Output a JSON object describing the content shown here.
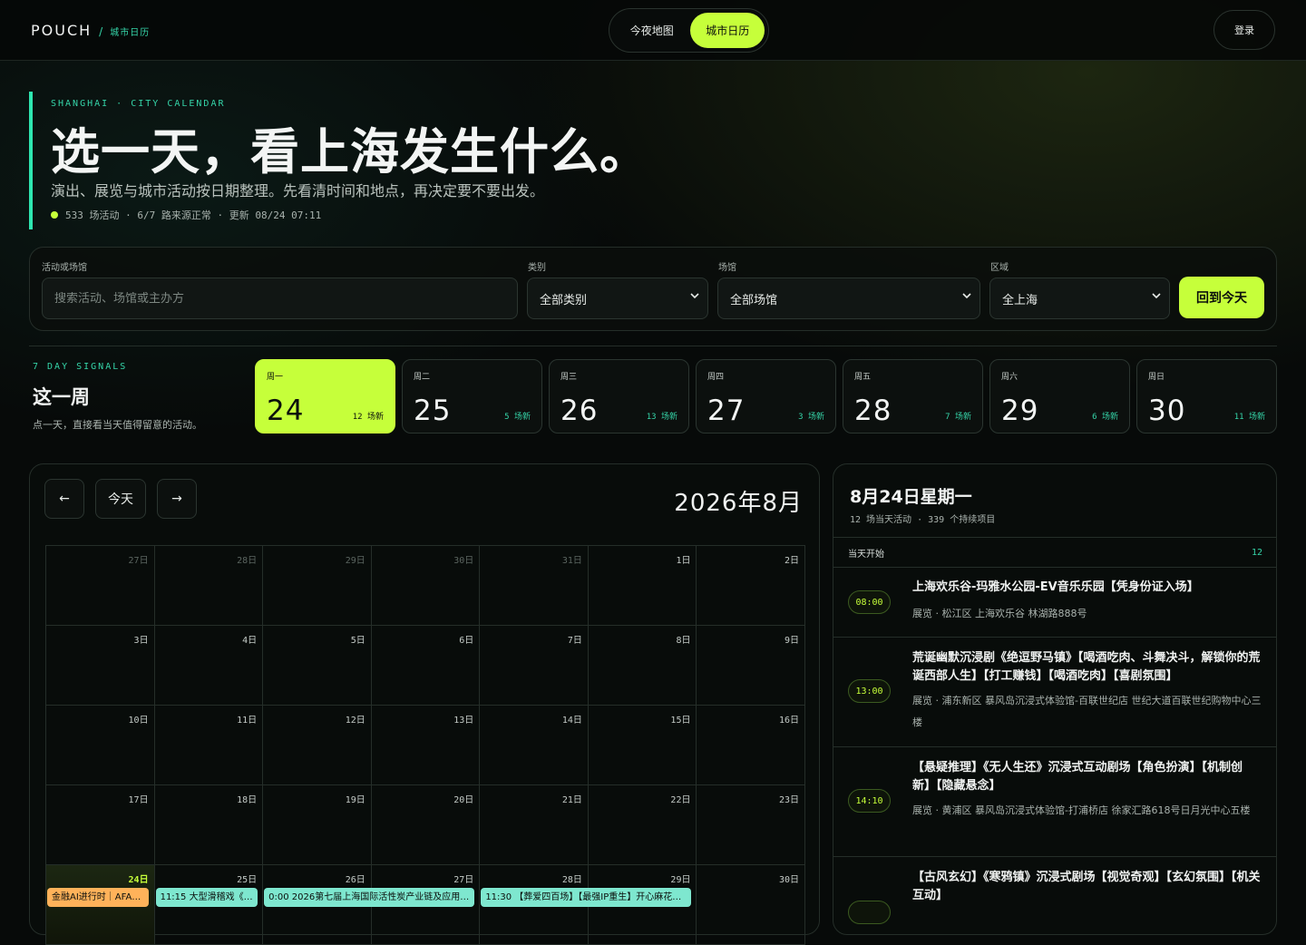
{
  "app": {
    "brand": "POUCH",
    "slash": "/",
    "section": "城市日历"
  },
  "nav": {
    "tab1": "今夜地图",
    "tab2": "城市日历",
    "login": "登录"
  },
  "hero": {
    "eyebrow": "SHANGHAI · CITY CALENDAR",
    "title": "选一天，看上海发生什么。",
    "desc": "演出、展览与城市活动按日期整理。先看清时间和地点，再决定要不要出发。",
    "status": "533 场活动 · 6/7 路来源正常 · 更新 08/24 07:11"
  },
  "filters": {
    "search_label": "活动或场馆",
    "search_placeholder": "搜索活动、场馆或主办方",
    "category_label": "类别",
    "category_value": "全部类别",
    "venue_label": "场馆",
    "venue_value": "全部场馆",
    "area_label": "区域",
    "area_value": "全上海",
    "today_button": "回到今天"
  },
  "week": {
    "eyebrow": "7 DAY SIGNALS",
    "title": "这一周",
    "desc": "点一天，直接看当天值得留意的活动。",
    "days": [
      {
        "weekday": "周一",
        "day": "24",
        "count": "12 场新"
      },
      {
        "weekday": "周二",
        "day": "25",
        "count": "5 场新"
      },
      {
        "weekday": "周三",
        "day": "26",
        "count": "13 场新"
      },
      {
        "weekday": "周四",
        "day": "27",
        "count": "3 场新"
      },
      {
        "weekday": "周五",
        "day": "28",
        "count": "7 场新"
      },
      {
        "weekday": "周六",
        "day": "29",
        "count": "6 场新"
      },
      {
        "weekday": "周日",
        "day": "30",
        "count": "11 场新"
      }
    ]
  },
  "calendar": {
    "prev": "←",
    "today": "今天",
    "next": "→",
    "title": "2026年8月",
    "rows": [
      [
        "27日",
        "28日",
        "29日",
        "30日",
        "31日",
        "1日",
        "2日"
      ],
      [
        "3日",
        "4日",
        "5日",
        "6日",
        "7日",
        "8日",
        "9日"
      ],
      [
        "10日",
        "11日",
        "12日",
        "13日",
        "14日",
        "15日",
        "16日"
      ],
      [
        "17日",
        "18日",
        "19日",
        "20日",
        "21日",
        "22日",
        "23日"
      ],
      [
        "24日",
        "25日",
        "26日",
        "27日",
        "28日",
        "29日",
        "30日"
      ]
    ],
    "events": {
      "d24": "金融AI进行时｜AFA…",
      "d25": "11:15 大型滑稽戏《兄…",
      "d26": "0:00 2026第七届上海国际活性炭产业链及应用…",
      "d28": "11:30 【葬爱四百场】【最强IP重生】开心麻花沉…"
    }
  },
  "panel": {
    "title": "8月24日星期一",
    "sub": "12 场当天活动 · 339 个持续项目",
    "section_label": "当天开始",
    "section_count": "12",
    "items": [
      {
        "time": "08:00",
        "title": "上海欢乐谷-玛雅水公园-EV音乐乐园【凭身份证入场】",
        "meta": "展览 · 松江区 上海欢乐谷 林湖路888号"
      },
      {
        "time": "13:00",
        "title": "荒诞幽默沉浸剧《绝逗野马镇》【喝酒吃肉、斗舞决斗，解锁你的荒诞西部人生】【打工赚钱】【喝酒吃肉】【喜剧氛围】",
        "meta": "展览 · 浦东新区 暴风岛沉浸式体验馆-百联世纪店 世纪大道百联世纪购物中心三楼"
      },
      {
        "time": "14:10",
        "title": "【悬疑推理】《无人生还》沉浸式互动剧场【角色扮演】【机制创新】【隐藏悬念】",
        "meta": "展览 · 黄浦区 暴风岛沉浸式体验馆-打浦桥店 徐家汇路618号日月光中心五楼"
      },
      {
        "time": "",
        "title": "【古风玄幻】《寒鸦镇》沉浸式剧场【视觉奇观】【玄幻氛围】【机关互动】",
        "meta": ""
      }
    ]
  },
  "colors": {
    "accent": "#c6ff3a",
    "teal": "#35d4a8",
    "event_orange": "#ffb25a",
    "event_teal": "#7ee7cf"
  }
}
